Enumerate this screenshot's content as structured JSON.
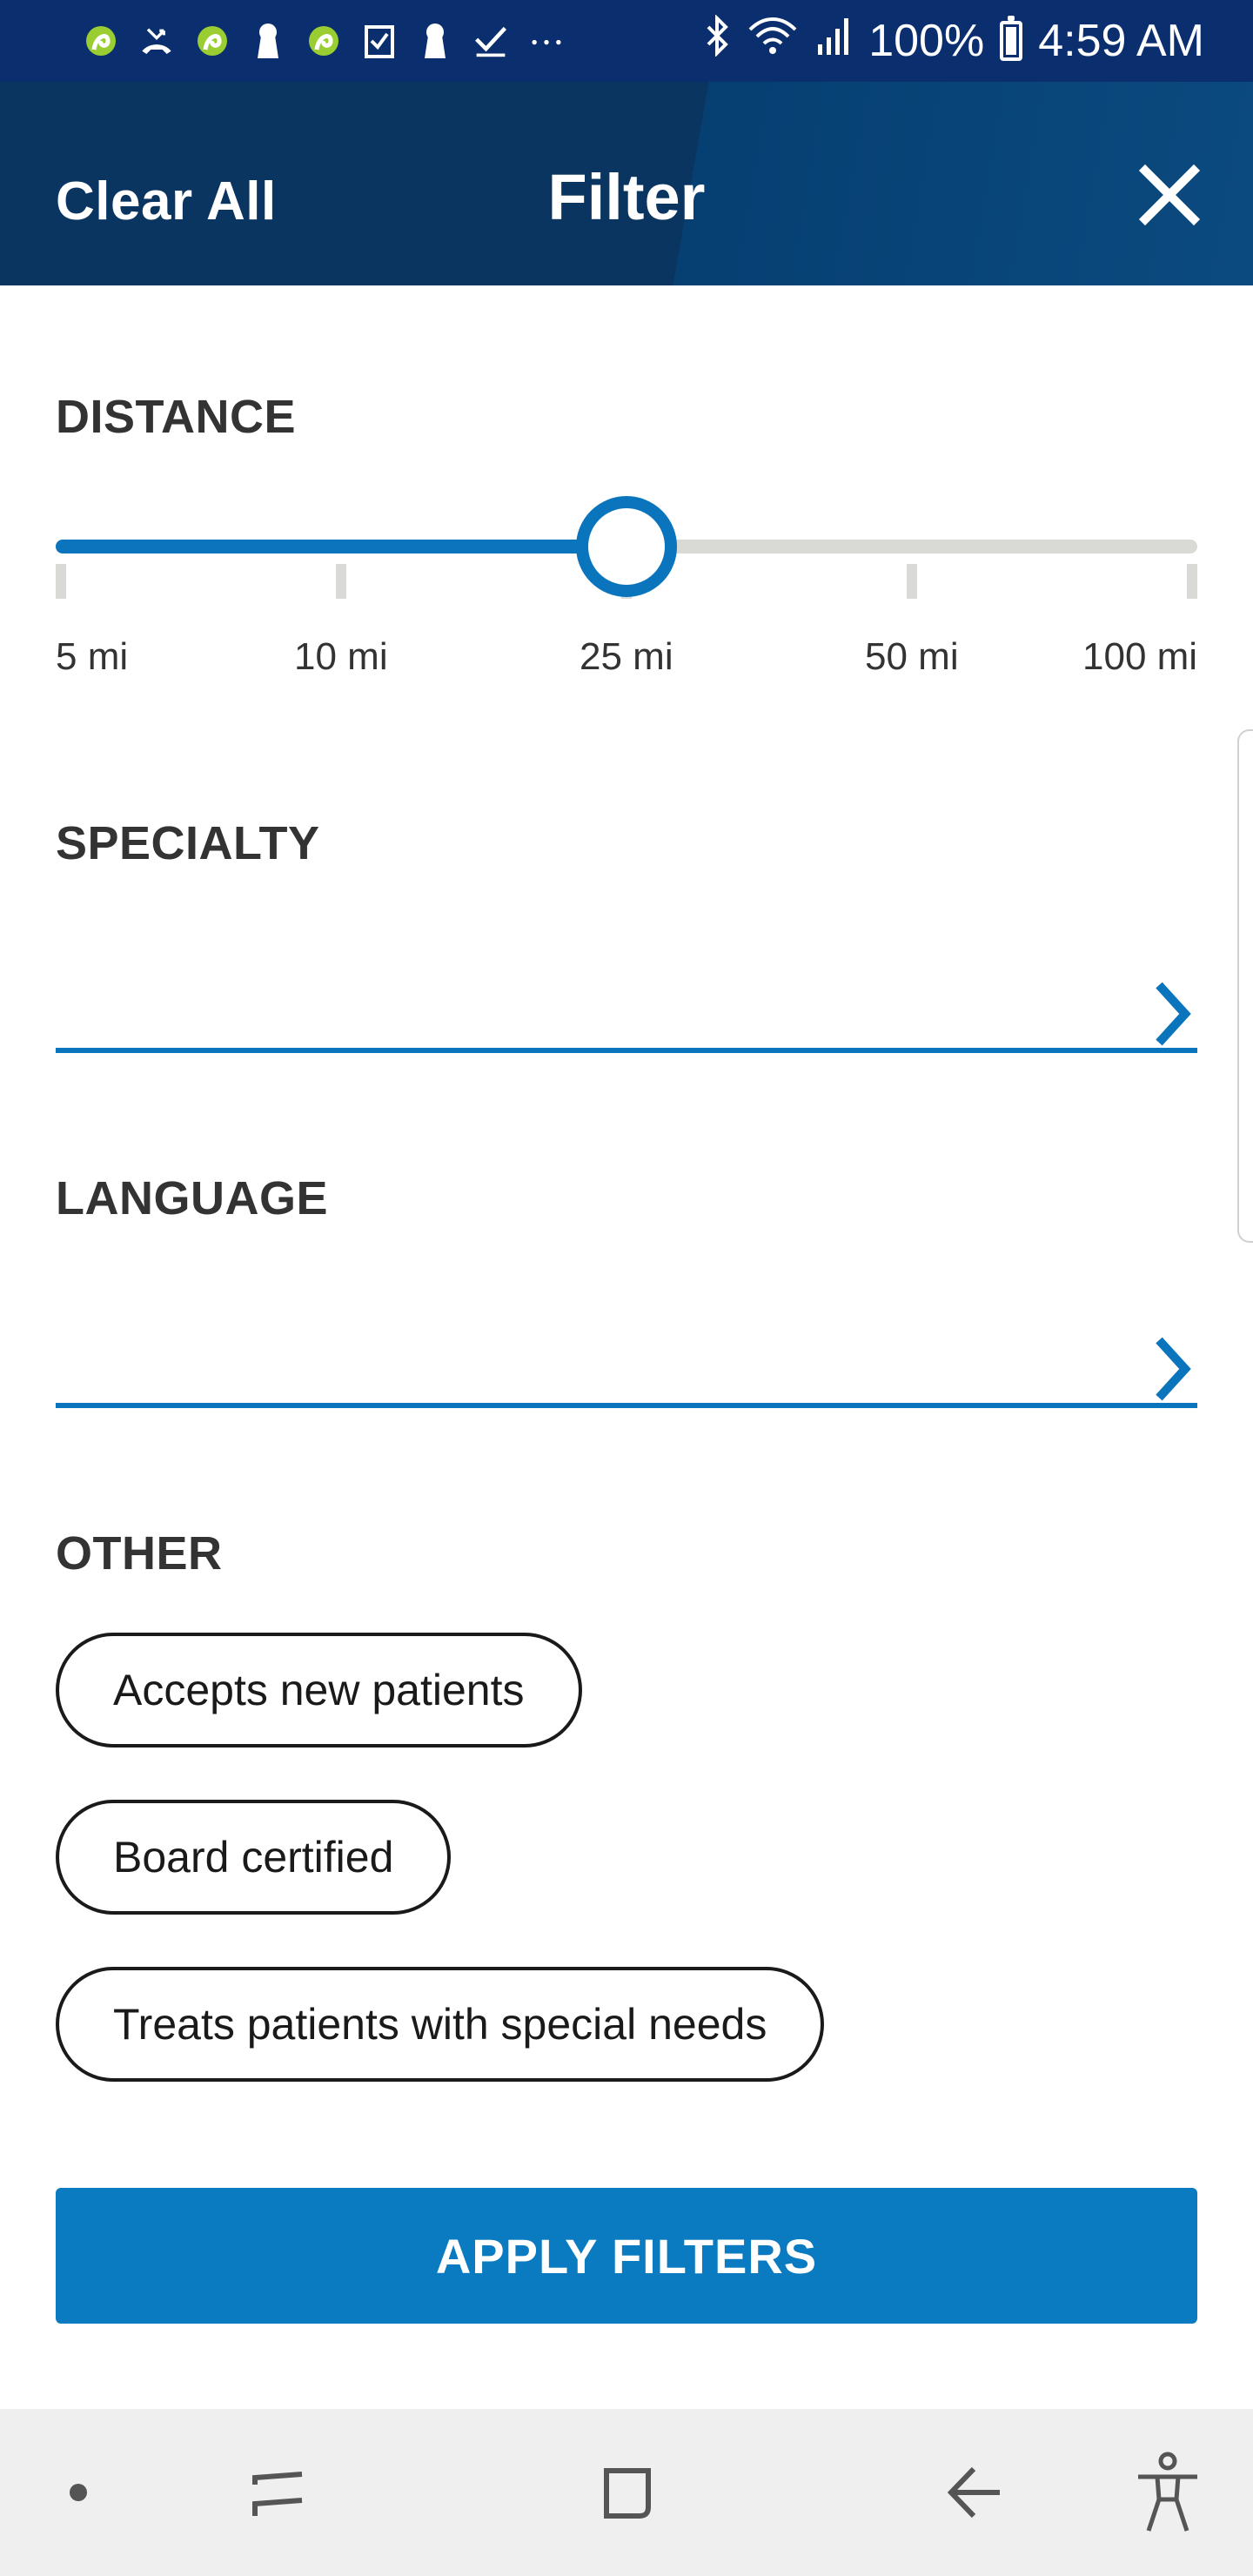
{
  "status_bar": {
    "icons": [
      "app-icon",
      "missed-call-icon",
      "app-icon",
      "keyhole-icon",
      "app-icon",
      "checkbox-icon",
      "keyhole-icon",
      "check-icon",
      "more-icon"
    ],
    "battery": "100%",
    "time": "4:59 AM"
  },
  "header": {
    "clear_all_label": "Clear All",
    "title": "Filter",
    "close_icon": "close-icon"
  },
  "distance": {
    "label": "DISTANCE",
    "options": [
      "5 mi",
      "10 mi",
      "25 mi",
      "50 mi",
      "100 mi"
    ],
    "selected": "25 mi",
    "selected_index": 2
  },
  "specialty": {
    "label": "SPECIALTY",
    "value": ""
  },
  "language": {
    "label": "LANGUAGE",
    "value": ""
  },
  "other": {
    "label": "OTHER",
    "chips": [
      "Accepts new patients",
      "Board certified",
      "Treats patients with special needs"
    ]
  },
  "apply_label": "APPLY FILTERS",
  "nav_bar": {
    "icons": [
      "dot-icon",
      "recent-apps-icon",
      "home-icon",
      "back-icon",
      "accessibility-icon"
    ]
  },
  "colors": {
    "header_bg": "#0a3561",
    "status_bg": "#0b2f6e",
    "accent": "#0a75bd",
    "button": "#0a7ac1"
  }
}
